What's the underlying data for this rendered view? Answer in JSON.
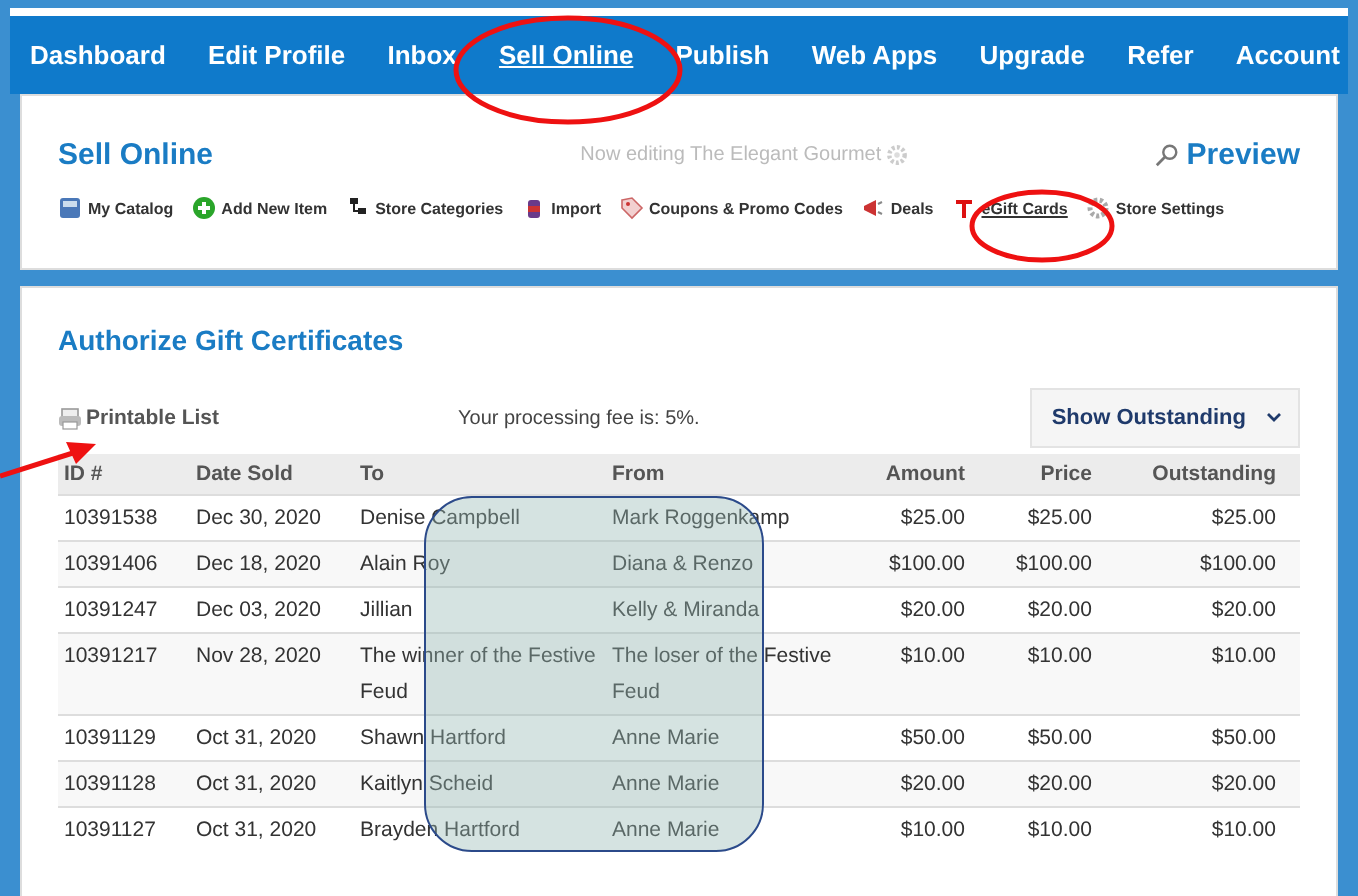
{
  "nav": [
    {
      "label": "Dashboard",
      "selected": false
    },
    {
      "label": "Edit Profile",
      "selected": false
    },
    {
      "label": "Inbox",
      "selected": false
    },
    {
      "label": "Sell Online",
      "selected": true
    },
    {
      "label": "Publish",
      "selected": false
    },
    {
      "label": "Web Apps",
      "selected": false
    },
    {
      "label": "Upgrade",
      "selected": false
    },
    {
      "label": "Refer",
      "selected": false
    },
    {
      "label": "Account",
      "selected": false
    }
  ],
  "header": {
    "title": "Sell Online",
    "editing": "Now editing The Elegant Gourmet",
    "preview": "Preview"
  },
  "toolbar": [
    {
      "label": "My Catalog",
      "selected": false
    },
    {
      "label": "Add New Item",
      "selected": false
    },
    {
      "label": "Store Categories",
      "selected": false
    },
    {
      "label": "Import",
      "selected": false
    },
    {
      "label": "Coupons & Promo Codes",
      "selected": false
    },
    {
      "label": "Deals",
      "selected": false
    },
    {
      "label": "eGift Cards",
      "selected": true
    },
    {
      "label": "Store Settings",
      "selected": false
    }
  ],
  "section": {
    "title": "Authorize Gift Certificates",
    "printable": "Printable List",
    "fee": "Your processing fee is: 5%.",
    "filter": "Show Outstanding"
  },
  "table": {
    "columns": [
      "ID #",
      "Date Sold",
      "To",
      "From",
      "Amount",
      "Price",
      "Outstanding"
    ],
    "rows": [
      [
        "10391538",
        "Dec 30, 2020",
        "Denise Campbell",
        "Mark Roggenkamp",
        "$25.00",
        "$25.00",
        "$25.00"
      ],
      [
        "10391406",
        "Dec 18, 2020",
        "Alain Roy",
        "Diana & Renzo",
        "$100.00",
        "$100.00",
        "$100.00"
      ],
      [
        "10391247",
        "Dec 03, 2020",
        "Jillian",
        "Kelly & Miranda",
        "$20.00",
        "$20.00",
        "$20.00"
      ],
      [
        "10391217",
        "Nov 28, 2020",
        "The winner of the Festive Feud",
        "The loser of the Festive Feud",
        "$10.00",
        "$10.00",
        "$10.00"
      ],
      [
        "10391129",
        "Oct 31, 2020",
        "Shawn Hartford",
        "Anne Marie",
        "$50.00",
        "$50.00",
        "$50.00"
      ],
      [
        "10391128",
        "Oct 31, 2020",
        "Kaitlyn Scheid",
        "Anne Marie",
        "$20.00",
        "$20.00",
        "$20.00"
      ],
      [
        "10391127",
        "Oct 31, 2020",
        "Brayden Hartford",
        "Anne Marie",
        "$10.00",
        "$10.00",
        "$10.00"
      ]
    ]
  }
}
